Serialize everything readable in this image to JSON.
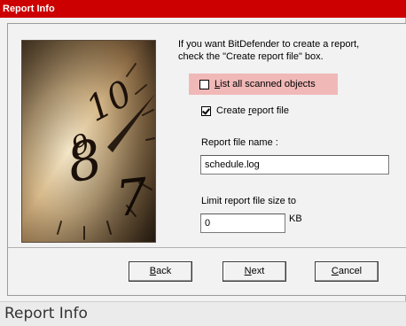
{
  "window": {
    "title": "Report Info"
  },
  "intro": {
    "line1": "If you want BitDefender to create a report,",
    "line2": "check the \"Create report file\" box."
  },
  "options": {
    "list_all_scanned": {
      "label_first": "L",
      "label_rest": "ist all scanned objects",
      "checked": false
    },
    "create_report": {
      "label_pre": "Create ",
      "label_accel": "r",
      "label_post": "eport file",
      "checked": true
    }
  },
  "report_file": {
    "label": "Report file name :",
    "value": "schedule.log"
  },
  "limit": {
    "label": "Limit report file size to",
    "value": "0",
    "unit": "KB"
  },
  "buttons": {
    "back": {
      "accel": "B",
      "rest": "ack"
    },
    "next": {
      "accel": "N",
      "rest": "ext"
    },
    "cancel": {
      "accel": "C",
      "rest": "ancel"
    }
  },
  "caption": {
    "text": "Report Info"
  },
  "colors": {
    "titlebar": "#cc0000",
    "highlight": "#f1b8b8"
  }
}
